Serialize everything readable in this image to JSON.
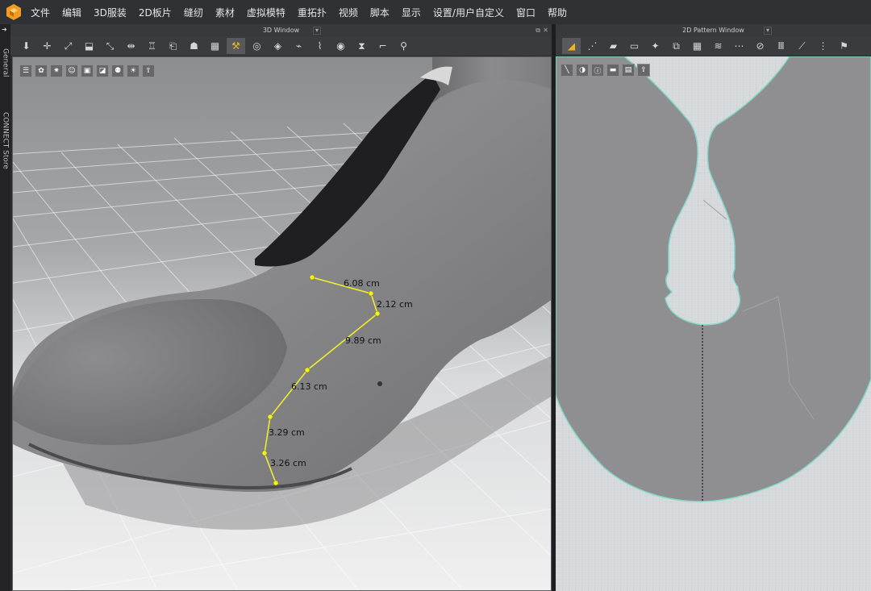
{
  "menu": {
    "items": [
      "文件",
      "编辑",
      "3D服装",
      "2D板片",
      "缝纫",
      "素材",
      "虚拟模特",
      "重拓扑",
      "视频",
      "脚本",
      "显示",
      "设置/用户自定义",
      "窗口",
      "帮助"
    ]
  },
  "sidebar": {
    "tabs": [
      "General",
      "CONNECT Store"
    ]
  },
  "panels": {
    "view3d_title": "3D Window",
    "view2d_title": "2D Pattern Window",
    "dropdown_glyph": "▾",
    "close_glyph": "✕",
    "float_glyph": "⧉"
  },
  "toolbar_3d": {
    "icons": [
      "select-move-icon",
      "transform-icon",
      "point-edit-icon",
      "fold-arrangement-icon",
      "pin-icon",
      "garment-fitting-icon",
      "hanger-icon",
      "arrange-icon",
      "tack-icon",
      "grid-texture-icon",
      "measure-tape-icon",
      "circumference-icon",
      "tape-icon",
      "puckering-icon",
      "elastic-icon",
      "button-icon",
      "zipper-icon",
      "pressure-icon",
      "runner-icon"
    ]
  },
  "toolbar_2d": {
    "icons": [
      "selection-tool-icon",
      "transform-pattern-icon",
      "polygon-icon",
      "rectangle-icon",
      "dart-icon",
      "segment-sewing-icon",
      "grid-texture-icon",
      "internal-line-icon",
      "topstitch-icon",
      "fold-icon",
      "pleat-icon",
      "measure-icon",
      "seam-allowance-icon",
      "shirt-icon"
    ]
  },
  "mini_tools_3d": {
    "icons": [
      "avatar-view-icon",
      "texture-view-icon",
      "render-mode-icon",
      "avatar-pose-icon",
      "garment-visibility-icon",
      "pattern-outline-icon",
      "avatar-skin-icon",
      "lighting-icon",
      "export-icon"
    ]
  },
  "mini_tools_2d": {
    "icons": [
      "draw-line-icon",
      "visibility-icon",
      "info-icon",
      "folder-icon",
      "select-all-icon",
      "export-icon"
    ]
  },
  "measurements": {
    "units": "cm",
    "segments": [
      "6.08 cm",
      "2.12 cm",
      "9.89 cm",
      "6.13 cm",
      "3.29 cm",
      "3.26 cm"
    ]
  },
  "colors": {
    "menubar_bg": "#303134",
    "toolbar_bg": "#3a3b3e",
    "accent": "#f1b51c",
    "measure_line": "#f2f226",
    "pattern_fill": "#8f8f91",
    "pattern_outline": "#7fd8c8",
    "pattern_bg": "#d7dadc"
  }
}
